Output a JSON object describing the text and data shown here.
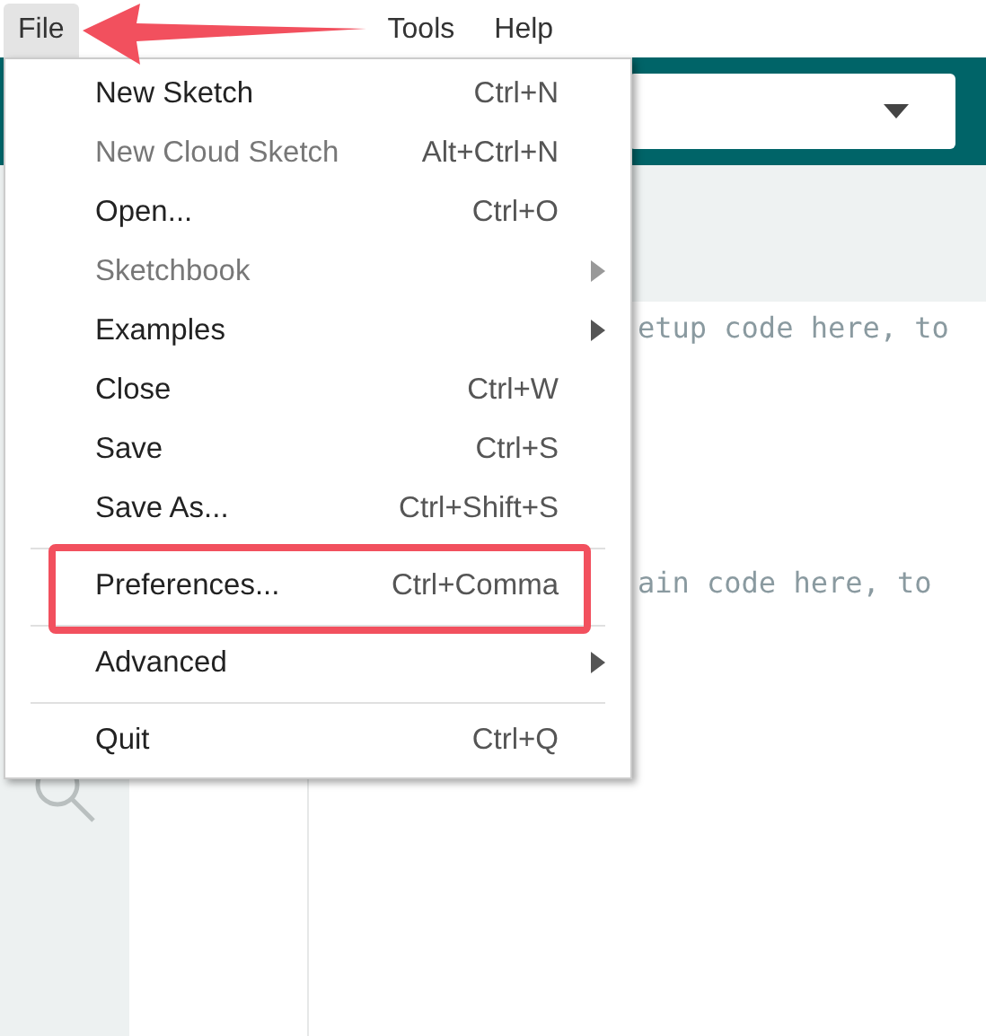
{
  "menu_bar": [
    {
      "label": "File",
      "selected": true
    },
    {
      "label": "Tools",
      "selected": false
    },
    {
      "label": "Help",
      "selected": false
    }
  ],
  "file_menu": [
    {
      "kind": "item",
      "label": "New Sketch",
      "shortcut": "Ctrl+N",
      "disabled": false,
      "submenu": false,
      "highlighted": false
    },
    {
      "kind": "item",
      "label": "New Cloud Sketch",
      "shortcut": "Alt+Ctrl+N",
      "disabled": true,
      "submenu": false,
      "highlighted": false
    },
    {
      "kind": "item",
      "label": "Open...",
      "shortcut": "Ctrl+O",
      "disabled": false,
      "submenu": false,
      "highlighted": false
    },
    {
      "kind": "item",
      "label": "Sketchbook",
      "disabled": true,
      "submenu": true,
      "highlighted": false
    },
    {
      "kind": "item",
      "label": "Examples",
      "disabled": false,
      "submenu": true,
      "highlighted": false
    },
    {
      "kind": "item",
      "label": "Close",
      "shortcut": "Ctrl+W",
      "disabled": false,
      "submenu": false,
      "highlighted": false
    },
    {
      "kind": "item",
      "label": "Save",
      "shortcut": "Ctrl+S",
      "disabled": false,
      "submenu": false,
      "highlighted": false
    },
    {
      "kind": "item",
      "label": "Save As...",
      "shortcut": "Ctrl+Shift+S",
      "disabled": false,
      "submenu": false,
      "highlighted": false
    },
    {
      "kind": "separator"
    },
    {
      "kind": "item",
      "label": "Preferences...",
      "shortcut": "Ctrl+Comma",
      "disabled": false,
      "submenu": false,
      "highlighted": true
    },
    {
      "kind": "separator"
    },
    {
      "kind": "item",
      "label": "Advanced",
      "disabled": false,
      "submenu": true,
      "highlighted": false
    },
    {
      "kind": "separator"
    },
    {
      "kind": "item",
      "label": "Quit",
      "shortcut": "Ctrl+Q",
      "disabled": false,
      "submenu": false,
      "highlighted": false
    }
  ],
  "editor": {
    "lines": [
      {
        "text": "etup code here, to"
      },
      {
        "text": "ain code here, to"
      }
    ]
  }
}
